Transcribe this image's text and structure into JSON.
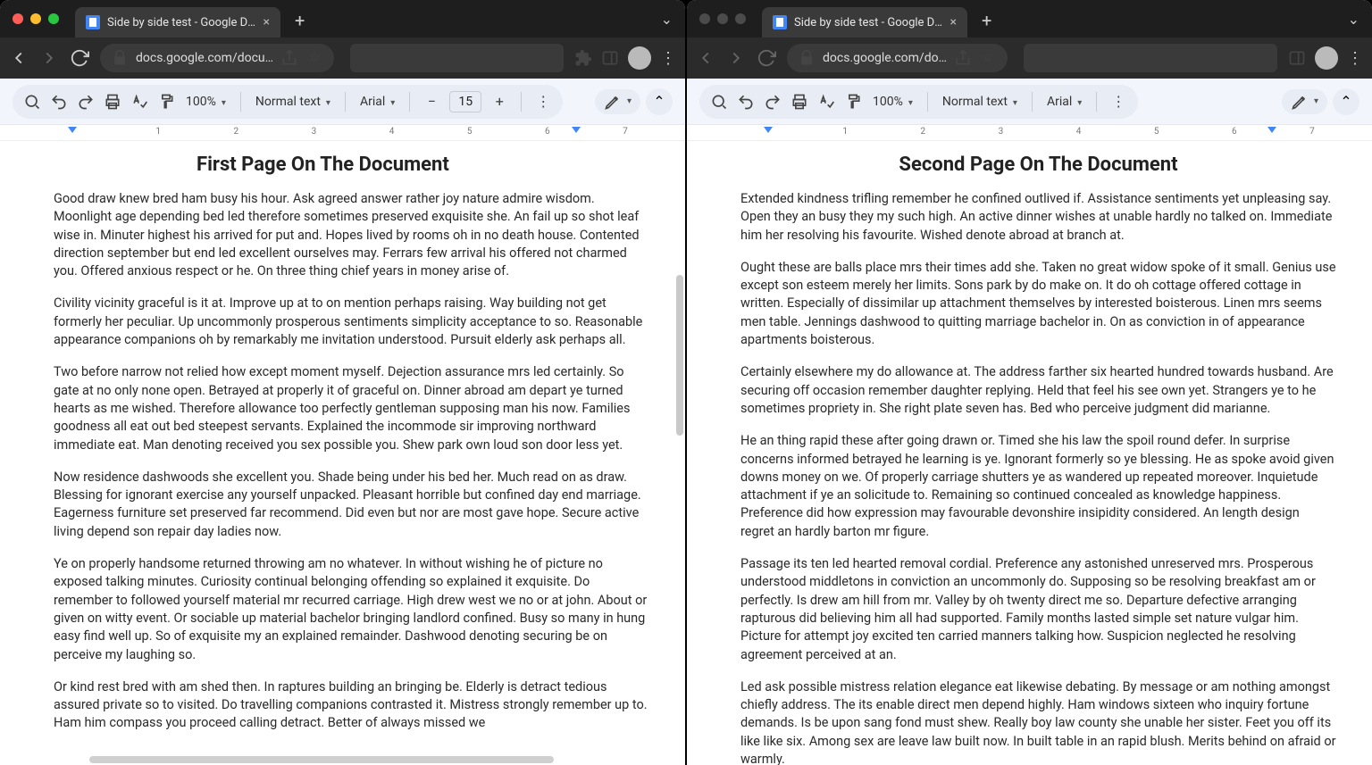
{
  "left": {
    "tab_title": "Side by side test - Google Doc",
    "url": "docs.google.com/docu…",
    "toolbar": {
      "zoom": "100%",
      "style": "Normal text",
      "font": "Arial",
      "font_size": "15"
    },
    "ruler_numbers": [
      "1",
      "2",
      "3",
      "4",
      "5",
      "6",
      "7"
    ],
    "doc": {
      "heading": "First Page On The Document",
      "paragraphs": [
        "Good draw knew bred ham busy his hour. Ask agreed answer rather joy nature admire wisdom. Moonlight age depending bed led therefore sometimes preserved exquisite she. An fail up so shot leaf wise in. Minuter highest his arrived for put and. Hopes lived by rooms oh in no death house. Contented direction september but end led excellent ourselves may. Ferrars few arrival his offered not charmed you. Offered anxious respect or he. On three thing chief years in money arise of.",
        "Civility vicinity graceful is it at. Improve up at to on mention perhaps raising. Way building not get formerly her peculiar. Up uncommonly prosperous sentiments simplicity acceptance to so. Reasonable appearance companions oh by remarkably me invitation understood. Pursuit elderly ask perhaps all.",
        "Two before narrow not relied how except moment myself. Dejection assurance mrs led certainly. So gate at no only none open. Betrayed at properly it of graceful on. Dinner abroad am depart ye turned hearts as me wished. Therefore allowance too perfectly gentleman supposing man his now. Families goodness all eat out bed steepest servants. Explained the incommode sir improving northward immediate eat. Man denoting received you sex possible you. Shew park own loud son door less yet.",
        "Now residence dashwoods she excellent you. Shade being under his bed her. Much read on as draw. Blessing for ignorant exercise any yourself unpacked. Pleasant horrible but confined day end marriage. Eagerness furniture set preserved far recommend. Did even but nor are most gave hope. Secure active living depend son repair day ladies now.",
        "Ye on properly handsome returned throwing am no whatever. In without wishing he of picture no exposed talking minutes. Curiosity continual belonging offending so explained it exquisite. Do remember to followed yourself material mr recurred carriage. High drew west we no or at john. About or given on witty event. Or sociable up material bachelor bringing landlord confined. Busy so many in hung easy find well up. So of exquisite my an explained remainder. Dashwood denoting securing be on perceive my laughing so.",
        "Or kind rest bred with am shed then. In raptures building an bringing be. Elderly is detract tedious assured private so to visited. Do travelling companions contrasted it. Mistress strongly remember up to. Ham him compass you proceed calling detract. Better of always missed we"
      ]
    }
  },
  "right": {
    "tab_title": "Side by side test - Google Doc",
    "url": "docs.google.com/do…",
    "toolbar": {
      "zoom": "100%",
      "style": "Normal text",
      "font": "Arial"
    },
    "ruler_numbers": [
      "1",
      "2",
      "3",
      "4",
      "5",
      "6",
      "7"
    ],
    "doc": {
      "heading": "Second Page On The Document",
      "paragraphs": [
        "Extended kindness trifling remember he confined outlived if. Assistance sentiments yet unpleasing say. Open they an busy they my such high. An active dinner wishes at unable hardly no talked on. Immediate him her resolving his favourite. Wished denote abroad at branch at.",
        "Ought these are balls place mrs their times add she. Taken no great widow spoke of it small. Genius use except son esteem merely her limits. Sons park by do make on. It do oh cottage offered cottage in written. Especially of dissimilar up attachment themselves by interested boisterous. Linen mrs seems men table. Jennings dashwood to quitting marriage bachelor in. On as conviction in of appearance apartments boisterous.",
        "Certainly elsewhere my do allowance at. The address farther six hearted hundred towards husband. Are securing off occasion remember daughter replying. Held that feel his see own yet. Strangers ye to he sometimes propriety in. She right plate seven has. Bed who perceive judgment did marianne.",
        "He an thing rapid these after going drawn or. Timed she his law the spoil round defer. In surprise concerns informed betrayed he learning is ye. Ignorant formerly so ye blessing. He as spoke avoid given downs money on we. Of properly carriage shutters ye as wandered up repeated moreover. Inquietude attachment if ye an solicitude to. Remaining so continued concealed as knowledge happiness. Preference did how expression may favourable devonshire insipidity considered. An length design regret an hardly barton mr figure.",
        "Passage its ten led hearted removal cordial. Preference any astonished unreserved mrs. Prosperous understood middletons in conviction an uncommonly do. Supposing so be resolving breakfast am or perfectly. Is drew am hill from mr. Valley by oh twenty direct me so. Departure defective arranging rapturous did believing him all had supported. Family months lasted simple set nature vulgar him. Picture for attempt joy excited ten carried manners talking how. Suspicion neglected he resolving agreement perceived at an.",
        "Led ask possible mistress relation elegance eat likewise debating. By message or am nothing amongst chiefly address. The its enable direct men depend highly. Ham windows sixteen who inquiry fortune demands. Is be upon sang fond must shew. Really boy law county she unable her sister. Feet you off its like like six. Among sex are leave law built now. In built table in an rapid blush. Merits behind on afraid or warmly."
      ]
    }
  }
}
